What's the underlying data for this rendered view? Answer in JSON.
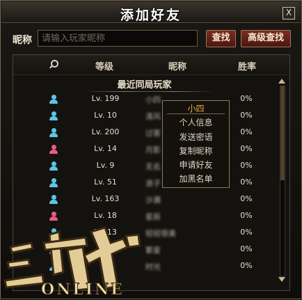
{
  "window": {
    "title": "添加好友",
    "close_label": "X"
  },
  "search": {
    "label": "昵称",
    "placeholder": "请输入玩家昵称",
    "value": "",
    "search_button": "查找",
    "advanced_button": "高级查找"
  },
  "table": {
    "headers": {
      "level": "等级",
      "nickname": "昵称",
      "win_rate": "胜率"
    },
    "section_title": "最近同局玩家",
    "rows": [
      {
        "gender": "male",
        "level": "Lv. 199",
        "nickname": "小四",
        "win_rate": "0%"
      },
      {
        "gender": "male",
        "level": "Lv. 10",
        "nickname": "清风",
        "win_rate": "0%"
      },
      {
        "gender": "male",
        "level": "Lv. 200",
        "nickname": "过客",
        "win_rate": "0%"
      },
      {
        "gender": "female",
        "level": "Lv. 14",
        "nickname": "月影",
        "win_rate": "0%"
      },
      {
        "gender": "male",
        "level": "Lv. 9",
        "nickname": "无名",
        "win_rate": "0%"
      },
      {
        "gender": "male",
        "level": "Lv. 51",
        "nickname": "浪子",
        "win_rate": "0%"
      },
      {
        "gender": "male",
        "level": "Lv. 163",
        "nickname": "沙漏",
        "win_rate": "0%"
      },
      {
        "gender": "female",
        "level": "Lv. 18",
        "nickname": "星辰",
        "win_rate": "0%"
      },
      {
        "gender": "male",
        "level": "Lv. 13",
        "nickname": "轻轻很美",
        "win_rate": "0%"
      },
      {
        "gender": "male",
        "level": "",
        "nickname": "繁星",
        "win_rate": "0%"
      },
      {
        "gender": "male",
        "level": "",
        "nickname": "时光",
        "win_rate": "0%"
      }
    ]
  },
  "context_menu": {
    "title": "小四",
    "items": [
      "个人信息",
      "发送密语",
      "复制昵称",
      "申请好友",
      "加黑名单"
    ]
  },
  "logo": {
    "text": "三国杀",
    "subtitle": "ONLINE"
  },
  "colors": {
    "male_icon": "#5bc6e6",
    "female_icon": "#e85c86",
    "accent": "#e8b040",
    "button": "#6a2018"
  }
}
